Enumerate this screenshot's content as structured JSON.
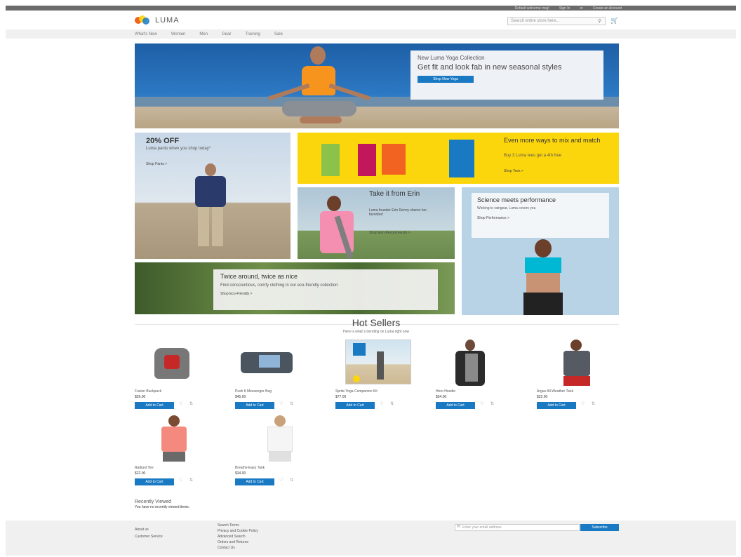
{
  "header": {
    "top_links": [
      "Default welcome msg!",
      "Sign In",
      "or",
      "Create an Account"
    ],
    "logo": "LUMA",
    "search_placeholder": "Search entire store here...",
    "nav": [
      "What's New",
      "Women",
      "Men",
      "Gear",
      "Training",
      "Sale"
    ]
  },
  "hero": {
    "eyebrow": "New Luma Yoga Collection",
    "title": "Get fit and look fab in new seasonal styles",
    "button": "Shop New Yoga"
  },
  "promos": {
    "pants": {
      "title": "20% OFF",
      "text": "Luma pants when you shop today*",
      "link": "Shop Pants >"
    },
    "tees": {
      "title": "Even more ways to mix and match",
      "text": "Buy 3 Luma tees get a 4th free",
      "link": "Shop Tees >"
    },
    "erin": {
      "title": "Take it from Erin",
      "text": "Luma founder Erin Renny shares her favorites!",
      "link": "Shop Erin Recommends >"
    },
    "performance": {
      "title": "Science meets performance",
      "text": "Wicking to raingear, Luma covers you",
      "link": "Shop Performance >"
    },
    "eco": {
      "title": "Twice around, twice as nice",
      "text": "Find conscientious, comfy clothing in our eco-friendly collection",
      "link": "Shop Eco-Friendly >"
    }
  },
  "hot_sellers": {
    "title": "Hot Sellers",
    "subtitle": "Here is what`s trending on Luma right now",
    "add_label": "Add to Cart",
    "products": [
      {
        "name": "Fusion Backpack",
        "price": "$59.00"
      },
      {
        "name": "Push It Messenger Bag",
        "price": "$45.00"
      },
      {
        "name": "Sprite Yoga Companion Kit",
        "price": "$77.00"
      },
      {
        "name": "Hero Hoodie",
        "price": "$54.00"
      },
      {
        "name": "Argus All-Weather Tank",
        "price": "$22.00"
      },
      {
        "name": "Radiant Tee",
        "price": "$22.00"
      },
      {
        "name": "Breathe-Easy Tank",
        "price": "$34.00"
      }
    ]
  },
  "recent": {
    "title": "Recently Viewed",
    "text": "You have no recently viewed items."
  },
  "footer": {
    "col1": [
      "About us",
      "Customer Service"
    ],
    "col2": [
      "Search Terms",
      "Privacy and Cookie Policy",
      "Advanced Search",
      "Orders and Returns",
      "Contact Us"
    ],
    "newsletter_placeholder": "Enter your email address",
    "subscribe": "Subscribe"
  },
  "colors": {
    "accent": "#1979c3",
    "yellow": "#fcd60c"
  }
}
